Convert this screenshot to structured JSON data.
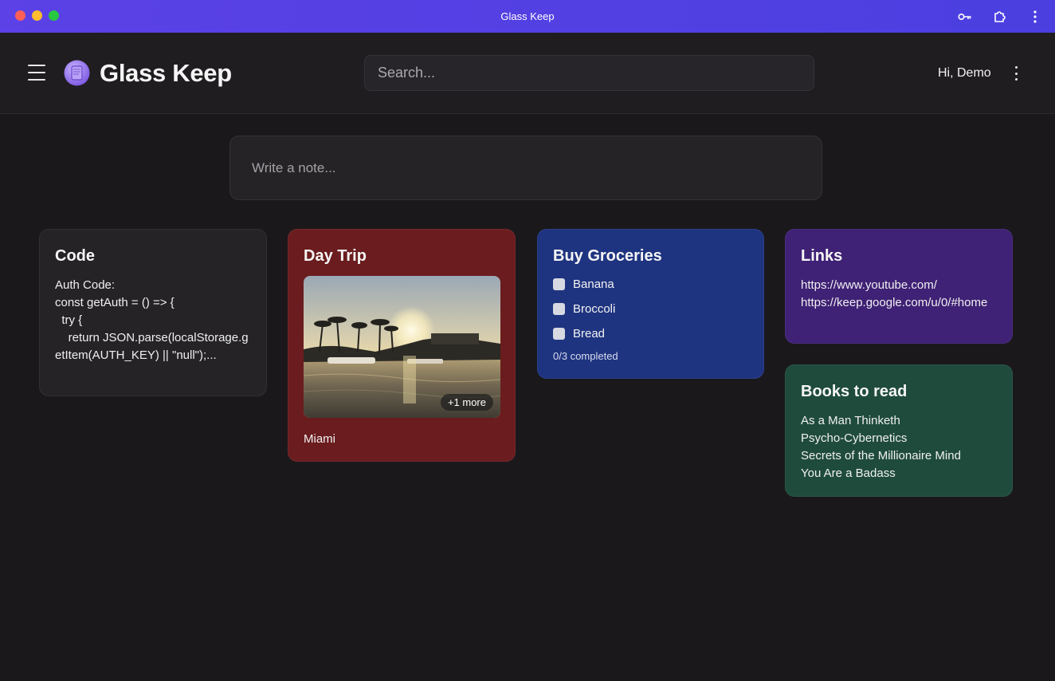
{
  "window": {
    "title": "Glass Keep",
    "icons": [
      "key-icon",
      "extension-icon",
      "more-vertical-icon"
    ]
  },
  "header": {
    "brand": "Glass Keep",
    "search_placeholder": "Search...",
    "greeting": "Hi, Demo"
  },
  "composer": {
    "placeholder": "Write a note..."
  },
  "notes": {
    "code": {
      "title": "Code",
      "body": "Auth Code:\nconst getAuth = () => {\n  try {\n    return JSON.parse(localStorage.getItem(AUTH_KEY) || \"null\");...",
      "color": "#252326"
    },
    "trip": {
      "title": "Day Trip",
      "more_badge": "+1 more",
      "caption": "Miami",
      "color": "#6b1c1e"
    },
    "groceries": {
      "title": "Buy Groceries",
      "items": [
        {
          "label": "Banana",
          "checked": false
        },
        {
          "label": "Broccoli",
          "checked": false
        },
        {
          "label": "Bread",
          "checked": false
        }
      ],
      "progress": "0/3 completed",
      "color": "#1f3480"
    },
    "links": {
      "title": "Links",
      "lines": [
        "https://www.youtube.com/",
        "https://keep.google.com/u/0/#home"
      ],
      "color": "#3f2175"
    },
    "books": {
      "title": "Books to read",
      "lines": [
        "As a Man Thinketh",
        "Psycho-Cybernetics",
        "Secrets of the Millionaire Mind",
        "You Are a Badass"
      ],
      "color": "#1f4b3d"
    }
  },
  "colors": {
    "titlebar": "#5b41e6",
    "background": "#1a181b",
    "header": "#1f1d20"
  }
}
